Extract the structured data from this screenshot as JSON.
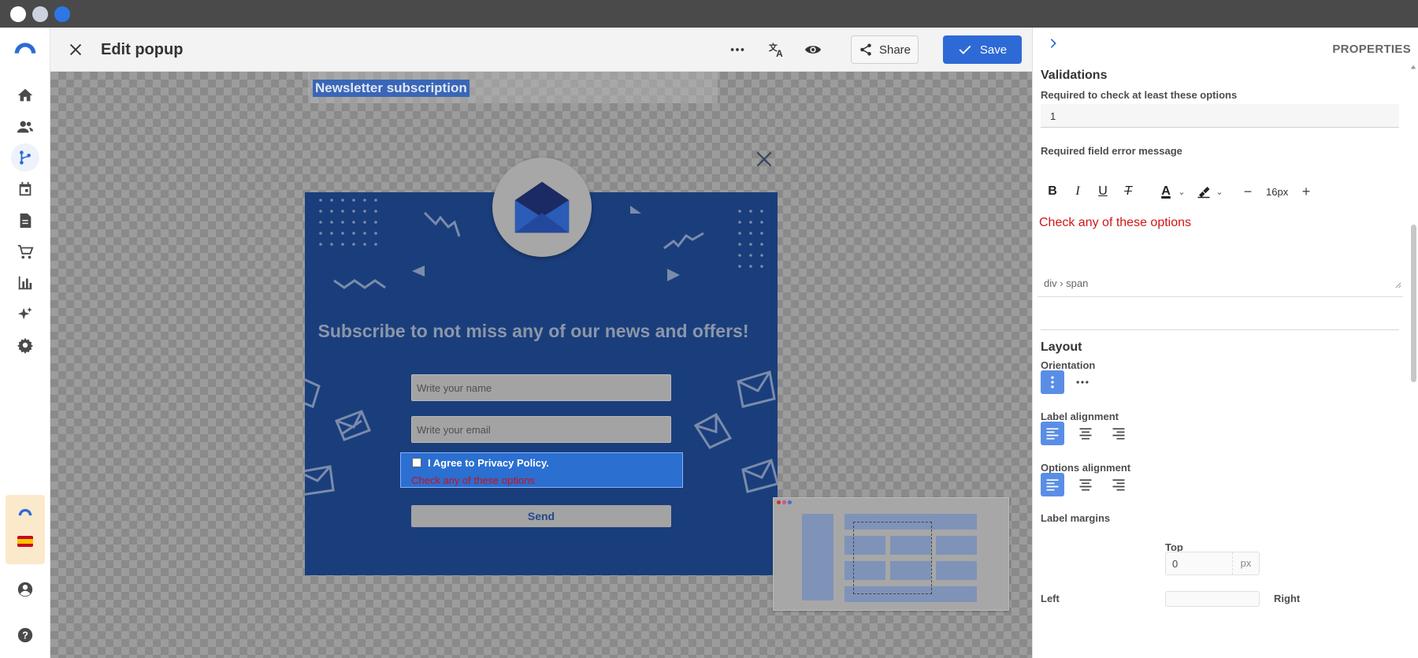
{
  "window": {
    "dots": [
      "#ffffff",
      "#cdd3de",
      "#2d77e4"
    ]
  },
  "editor": {
    "title": "Edit popup",
    "share_label": "Share",
    "save_label": "Save"
  },
  "canvas": {
    "selected_label": "Newsletter subscription",
    "popup": {
      "headline": "Subscribe to not miss any of our news and offers!",
      "name_placeholder": "Write your name",
      "email_placeholder": "Write your email",
      "agree_label": "I Agree to Privacy Policy.",
      "error_message": "Check any of these options",
      "send_label": "Send"
    }
  },
  "properties": {
    "title": "PROPERTIES",
    "validations_heading": "Validations",
    "min_options_label": "Required to check at least these options",
    "min_options_value": "1",
    "error_msg_label": "Required field error message",
    "font_size": "16px",
    "error_msg_text": "Check any of these options",
    "breadcrumb": "div › span",
    "layout_heading": "Layout",
    "orientation_label": "Orientation",
    "label_alignment_label": "Label alignment",
    "options_alignment_label": "Options alignment",
    "label_margins_label": "Label margins",
    "top_label": "Top",
    "top_value": "0",
    "unit": "px",
    "left_label": "Left",
    "right_label": "Right"
  },
  "colors": {
    "accent": "#2d6ad6",
    "error": "#d21414",
    "popup_bg": "#1a3e7c"
  }
}
